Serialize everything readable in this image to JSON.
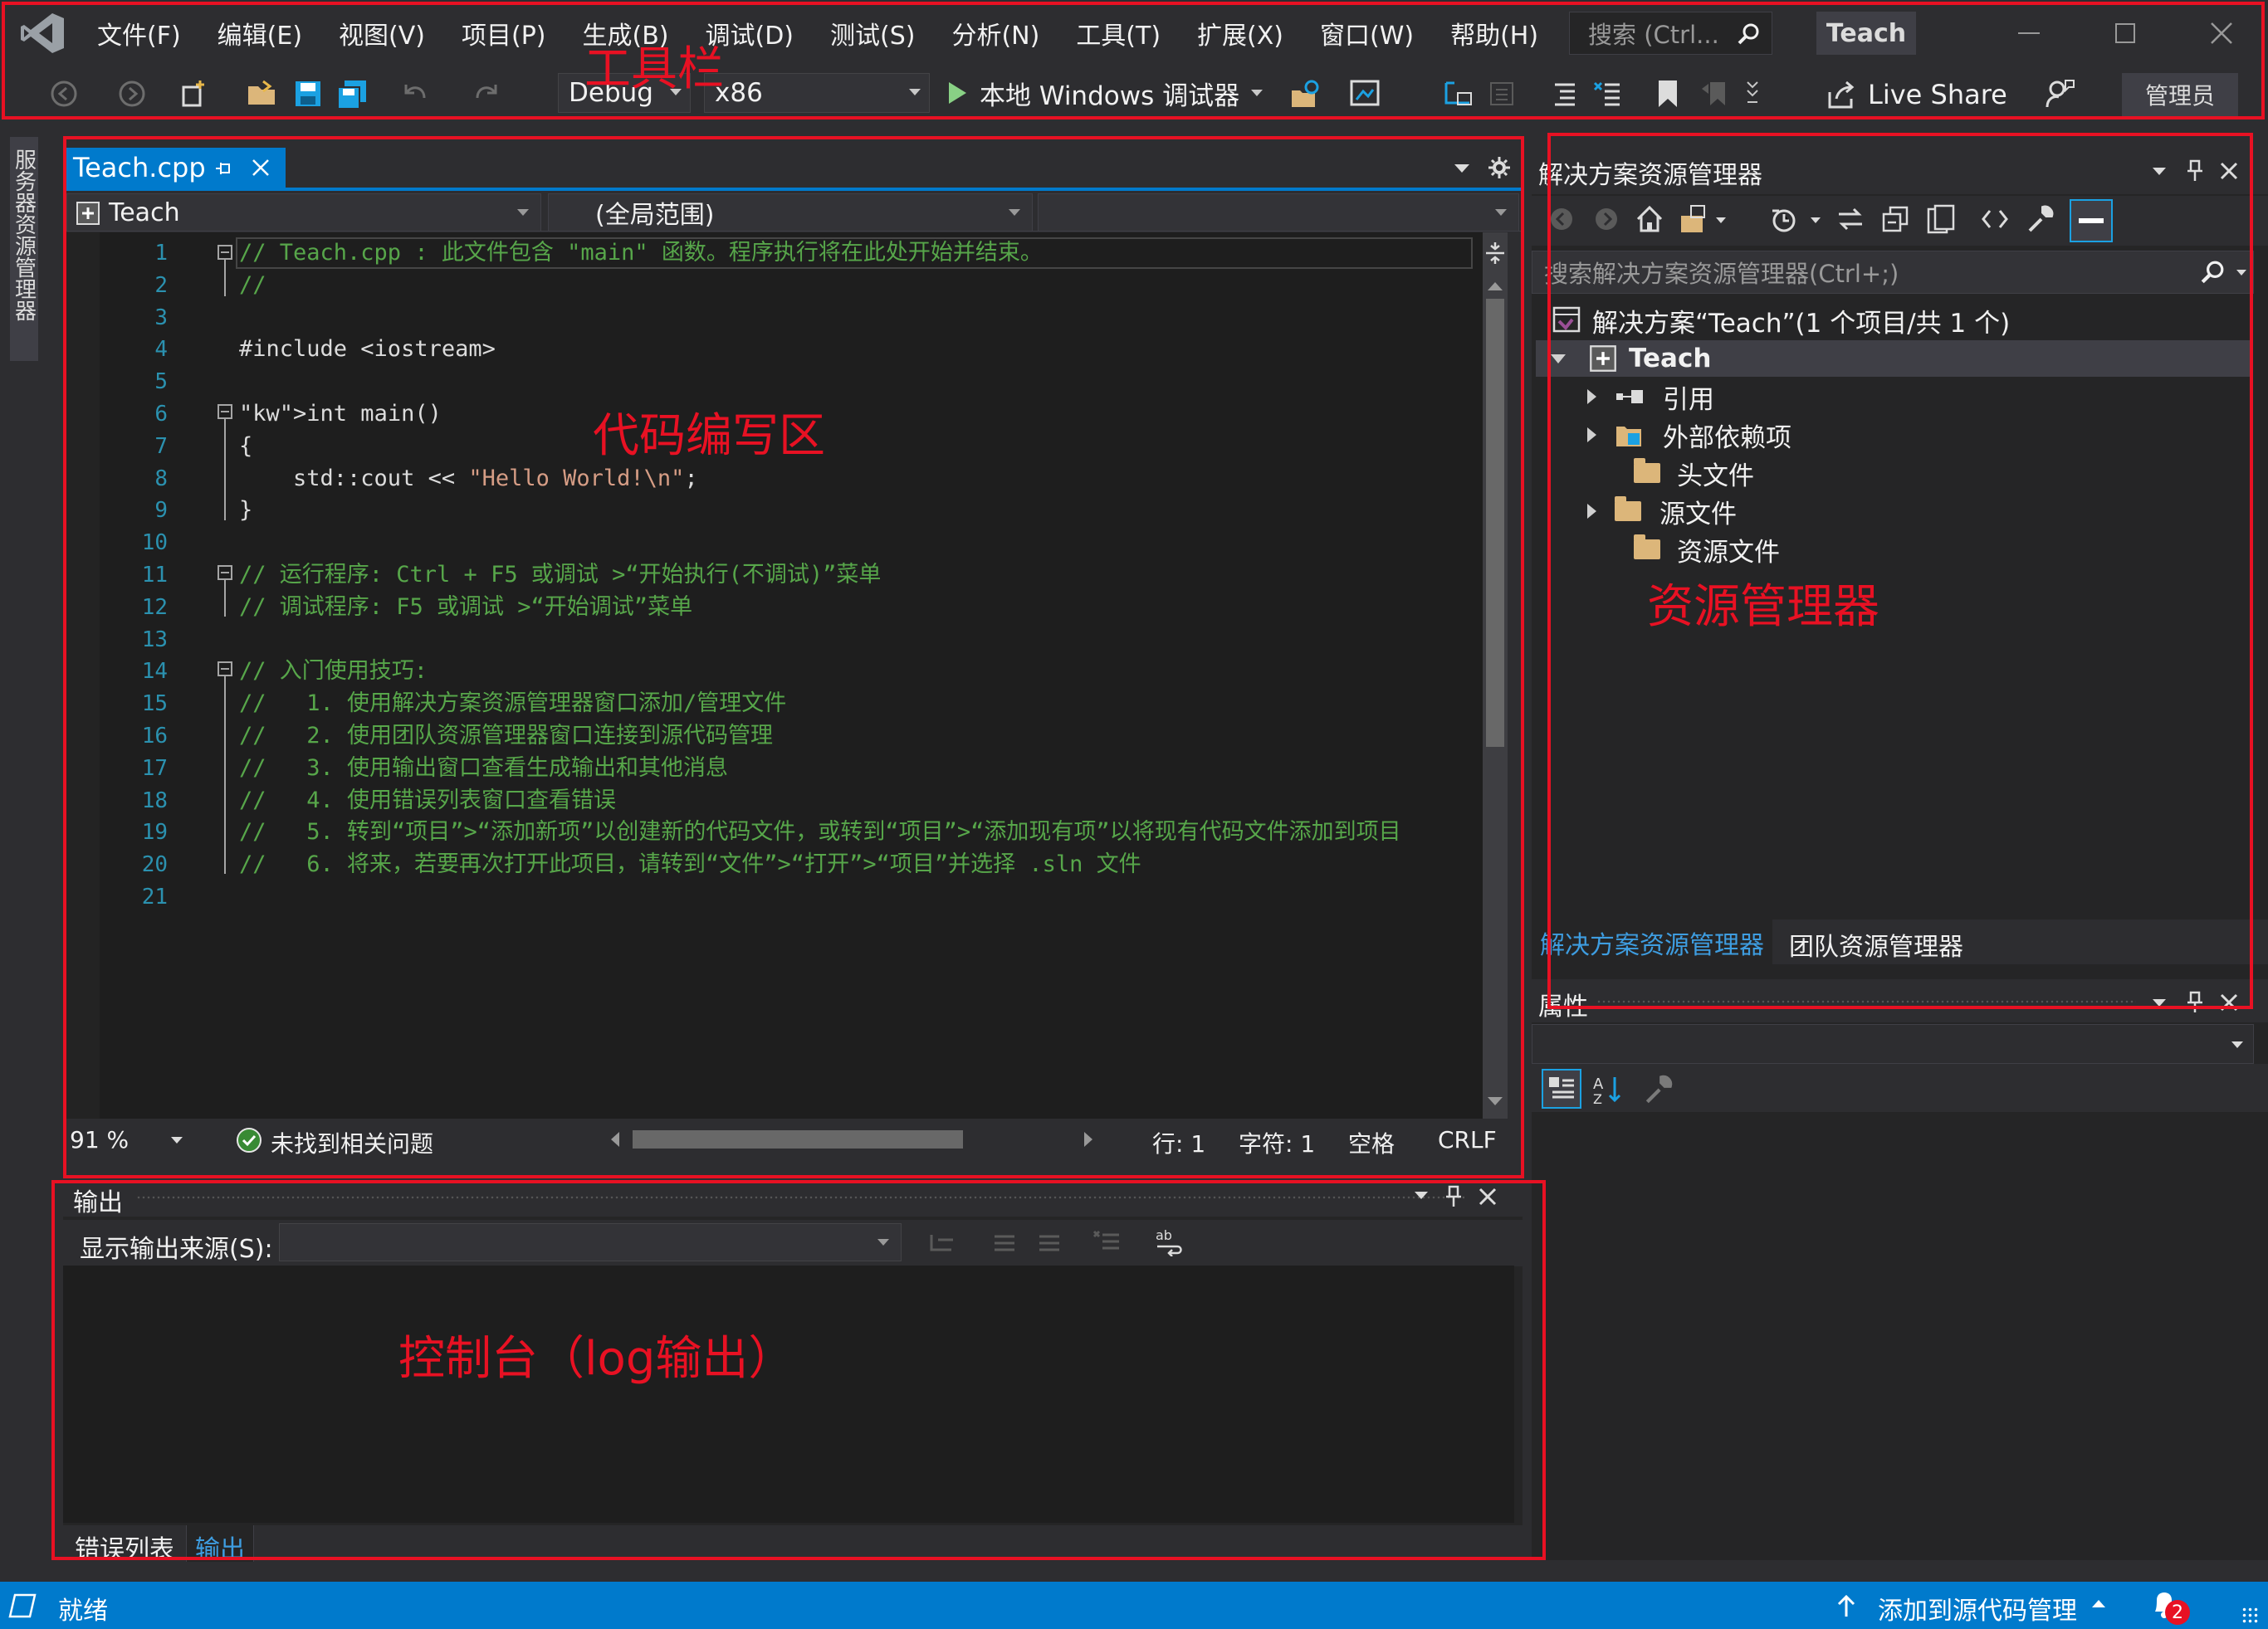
{
  "menu": {
    "items": [
      "文件(F)",
      "编辑(E)",
      "视图(V)",
      "项目(P)",
      "生成(B)",
      "调试(D)",
      "测试(S)",
      "分析(N)",
      "工具(T)",
      "扩展(X)",
      "窗口(W)",
      "帮助(H)"
    ]
  },
  "search": {
    "placeholder": "搜索 (Ctrl..."
  },
  "window": {
    "title": "Teach"
  },
  "toolbar": {
    "config": "Debug",
    "platform": "x86",
    "run_label": "本地 Windows 调试器",
    "live_share": "Live Share",
    "admin": "管理员"
  },
  "left_tab": {
    "label": "服务器资源管理器"
  },
  "editor": {
    "tab_label": "Teach.cpp",
    "nav_project": "Teach",
    "nav_scope": "(全局范围)",
    "lines": [
      {
        "n": "1",
        "text": "// Teach.cpp : 此文件包含 \"main\" 函数。程序执行将在此处开始并结束。",
        "cls": "cmt"
      },
      {
        "n": "2",
        "text": "//",
        "cls": "cmt"
      },
      {
        "n": "3",
        "text": "",
        "cls": ""
      },
      {
        "n": "4",
        "text": "#include <iostream>",
        "cls": ""
      },
      {
        "n": "5",
        "text": "",
        "cls": ""
      },
      {
        "n": "6",
        "text": "int main()",
        "cls": "kwline"
      },
      {
        "n": "7",
        "text": "{",
        "cls": ""
      },
      {
        "n": "8",
        "text": "    std::cout << \"Hello World!\\n\";",
        "cls": "strline"
      },
      {
        "n": "9",
        "text": "}",
        "cls": ""
      },
      {
        "n": "10",
        "text": "",
        "cls": ""
      },
      {
        "n": "11",
        "text": "// 运行程序: Ctrl + F5 或调试 >“开始执行(不调试)”菜单",
        "cls": "cmt"
      },
      {
        "n": "12",
        "text": "// 调试程序: F5 或调试 >“开始调试”菜单",
        "cls": "cmt"
      },
      {
        "n": "13",
        "text": "",
        "cls": ""
      },
      {
        "n": "14",
        "text": "// 入门使用技巧:",
        "cls": "cmt"
      },
      {
        "n": "15",
        "text": "//   1. 使用解决方案资源管理器窗口添加/管理文件",
        "cls": "cmt"
      },
      {
        "n": "16",
        "text": "//   2. 使用团队资源管理器窗口连接到源代码管理",
        "cls": "cmt"
      },
      {
        "n": "17",
        "text": "//   3. 使用输出窗口查看生成输出和其他消息",
        "cls": "cmt"
      },
      {
        "n": "18",
        "text": "//   4. 使用错误列表窗口查看错误",
        "cls": "cmt"
      },
      {
        "n": "19",
        "text": "//   5. 转到“项目”>“添加新项”以创建新的代码文件，或转到“项目”>“添加现有项”以将现有代码文件添加到项目",
        "cls": "cmt"
      },
      {
        "n": "20",
        "text": "//   6. 将来，若要再次打开此项目，请转到“文件”>“打开”>“项目”并选择 .sln 文件",
        "cls": "cmt"
      },
      {
        "n": "21",
        "text": "",
        "cls": ""
      }
    ],
    "zoom": "91 %",
    "issues": "未找到相关问题",
    "line_pos": "行: 1",
    "char_pos": "字符: 1",
    "indent": "空格",
    "eol": "CRLF"
  },
  "output": {
    "title": "输出",
    "source_label": "显示输出来源(S):",
    "tabs": [
      "错误列表",
      "输出"
    ]
  },
  "solution_explorer": {
    "title": "解决方案资源管理器",
    "search_placeholder": "搜索解决方案资源管理器(Ctrl+;)",
    "solution": "解决方案“Teach”(1 个项目/共 1 个)",
    "project": "Teach",
    "nodes": [
      "引用",
      "外部依赖项",
      "头文件",
      "源文件",
      "资源文件"
    ],
    "tabs": [
      "解决方案资源管理器",
      "团队资源管理器"
    ]
  },
  "properties": {
    "title": "属性"
  },
  "statusbar": {
    "ready": "就绪",
    "source_control": "添加到源代码管理",
    "notifications": "2"
  },
  "annotations": {
    "toolbar": "工具栏",
    "code_area": "代码编写区",
    "explorer": "资源管理器",
    "console": "控制台（log输出）"
  },
  "colors": {
    "accent": "#007acc",
    "annotation": "#e81123",
    "comment": "#57a64a",
    "keyword": "#569cd6",
    "string": "#d69d85"
  }
}
